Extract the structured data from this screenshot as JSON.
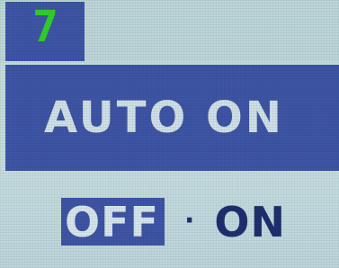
{
  "osd": {
    "index": "7",
    "title": "AUTO ON",
    "options": [
      {
        "label": "OFF",
        "selected": true
      },
      {
        "label": "ON",
        "selected": false
      }
    ],
    "separator": "·"
  },
  "colors": {
    "highlight": "#3e55a5",
    "background": "#c3dbdc",
    "index_text": "#2fd02a",
    "title_text": "#cfe0e6",
    "option_text": "#1e2f6f"
  }
}
